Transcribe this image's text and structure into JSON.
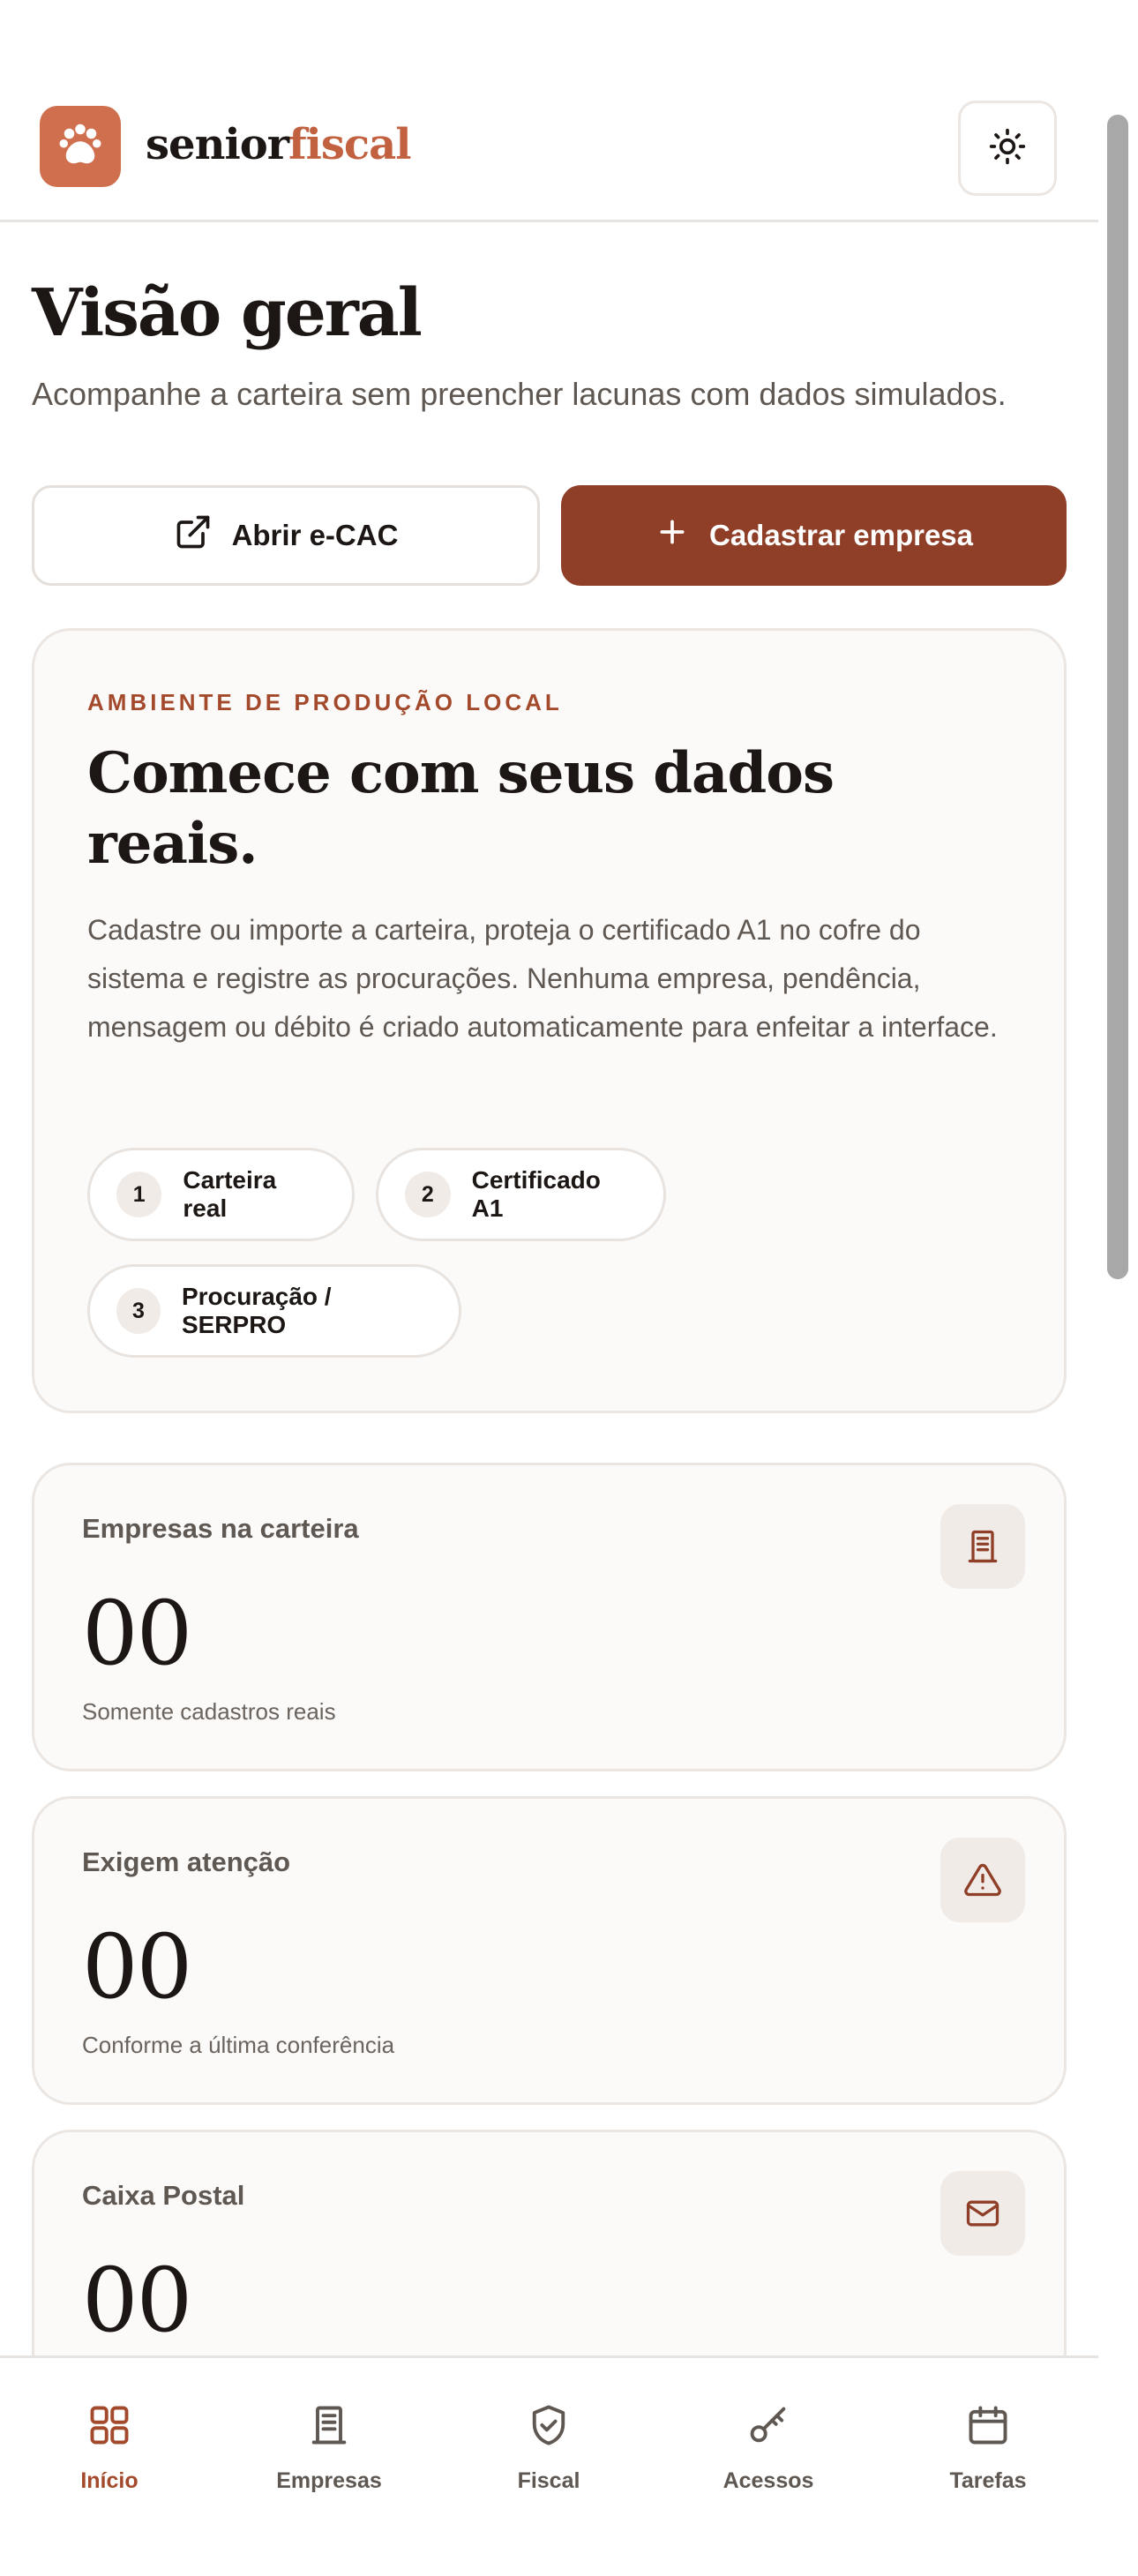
{
  "brand": {
    "part1": "senior",
    "part2": "fiscal",
    "logo_icon": "paw-icon"
  },
  "header": {
    "theme_icon": "sun-icon"
  },
  "page": {
    "title": "Visão geral",
    "subtitle": "Acompanhe a carteira sem preencher lacunas com dados simulados."
  },
  "actions": {
    "open_ecac": "Abrir e-CAC",
    "register_company": "Cadastrar empresa"
  },
  "hero": {
    "eyebrow": "AMBIENTE DE PRODUÇÃO LOCAL",
    "title": "Comece com seus dados reais.",
    "text": "Cadastre ou importe a carteira, proteja o certificado A1 no cofre do sistema e registre as procurações. Nenhuma empresa, pendência, mensagem ou débito é criado automaticamente para enfeitar a interface.",
    "steps": [
      {
        "num": "1",
        "label": "Carteira real"
      },
      {
        "num": "2",
        "label": "Certificado A1"
      },
      {
        "num": "3",
        "label": "Procuração / SERPRO"
      }
    ]
  },
  "stats": [
    {
      "label": "Empresas na carteira",
      "value": "00",
      "note": "Somente cadastros reais",
      "icon": "building-icon"
    },
    {
      "label": "Exigem atenção",
      "value": "00",
      "note": "Conforme a última conferência",
      "icon": "warning-icon"
    },
    {
      "label": "Caixa Postal",
      "value": "00",
      "note": "",
      "icon": "mail-icon"
    }
  ],
  "nav": [
    {
      "label": "Início",
      "icon": "grid-icon",
      "active": true
    },
    {
      "label": "Empresas",
      "icon": "building-icon",
      "active": false
    },
    {
      "label": "Fiscal",
      "icon": "shield-check-icon",
      "active": false
    },
    {
      "label": "Acessos",
      "icon": "key-icon",
      "active": false
    },
    {
      "label": "Tarefas",
      "icon": "calendar-icon",
      "active": false
    }
  ],
  "colors": {
    "accent": "#8f3e27",
    "brand": "#c2613f",
    "logo_bg": "#d06f4d",
    "active_nav": "#a44a2c"
  }
}
